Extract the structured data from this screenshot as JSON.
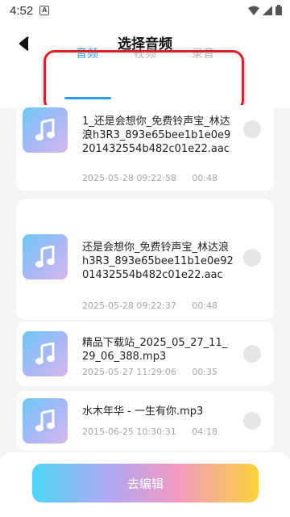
{
  "status_bar": {
    "time": "4:52",
    "notification_badge": "A"
  },
  "header": {
    "title": "选择音频",
    "tabs": [
      {
        "label": "音频",
        "active": true
      },
      {
        "label": "视频",
        "active": false
      },
      {
        "label": "录音",
        "active": false
      }
    ]
  },
  "files": [
    {
      "name": "1_还是会想你_免费铃声宝_林达浪h3R3_893e65bee1b1e0e9201432554b482c01e22.aac",
      "date": "2025-05-28 09:22:58",
      "duration": "00:48",
      "selected": false
    },
    {
      "name": "还是会想你_免费铃声宝_林达浪h3R3_893e65bee11b1e0e9201432554b482c01e22.aac",
      "date": "2025-05-28 09:22:37",
      "duration": "00:48",
      "selected": false
    },
    {
      "name": "精品下载站_2025_05_27_11_29_06_388.mp3",
      "date": "2025-05-27 11:29:06",
      "duration": "00:35",
      "selected": false
    },
    {
      "name": "水木年华 - 一生有你.mp3",
      "date": "2015-06-25 10:30:31",
      "duration": "04:18",
      "selected": false
    }
  ],
  "footer": {
    "edit_button_label": "去编辑"
  },
  "colors": {
    "accent": "#2a9ee8",
    "highlight_box": "#d92323"
  }
}
